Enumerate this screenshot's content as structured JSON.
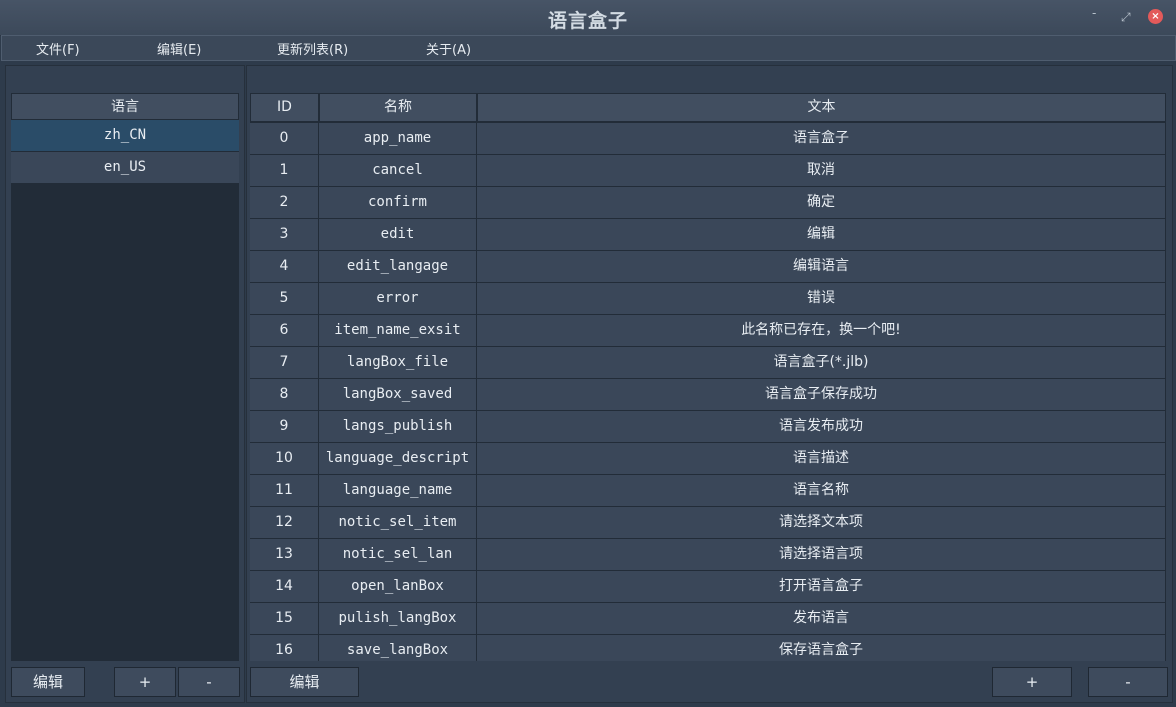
{
  "window": {
    "title": "语言盒子",
    "min": "-",
    "max": "⤢",
    "close": "×"
  },
  "menu": [
    "文件(F)",
    "编辑(E)",
    "更新列表(R)",
    "关于(A)"
  ],
  "left": {
    "header": "语言",
    "languages": [
      "zh_CN",
      "en_US"
    ],
    "edit_button": "编辑",
    "add_button": "+",
    "remove_button": "-"
  },
  "right": {
    "columns": [
      "ID",
      "名称",
      "文本"
    ],
    "rows": [
      {
        "id": "0",
        "name": "app_name",
        "text": "语言盒子"
      },
      {
        "id": "1",
        "name": "cancel",
        "text": "取消"
      },
      {
        "id": "2",
        "name": "confirm",
        "text": "确定"
      },
      {
        "id": "3",
        "name": "edit",
        "text": "编辑"
      },
      {
        "id": "4",
        "name": "edit_langage",
        "text": "编辑语言"
      },
      {
        "id": "5",
        "name": "error",
        "text": "错误"
      },
      {
        "id": "6",
        "name": "item_name_exsit",
        "text": "此名称已存在，换一个吧!"
      },
      {
        "id": "7",
        "name": "langBox_file",
        "text": "语言盒子(*.jlb)"
      },
      {
        "id": "8",
        "name": "langBox_saved",
        "text": "语言盒子保存成功"
      },
      {
        "id": "9",
        "name": "langs_publish",
        "text": "语言发布成功"
      },
      {
        "id": "10",
        "name": "language_descript",
        "text": "语言描述"
      },
      {
        "id": "11",
        "name": "language_name",
        "text": "语言名称"
      },
      {
        "id": "12",
        "name": "notic_sel_item",
        "text": "请选择文本项"
      },
      {
        "id": "13",
        "name": "notic_sel_lan",
        "text": "请选择语言项"
      },
      {
        "id": "14",
        "name": "open_lanBox",
        "text": "打开语言盒子"
      },
      {
        "id": "15",
        "name": "pulish_langBox",
        "text": "发布语言"
      },
      {
        "id": "16",
        "name": "save_langBox",
        "text": "保存语言盒子"
      }
    ],
    "edit_button": "编辑",
    "add_button": "+",
    "remove_button": "-"
  }
}
